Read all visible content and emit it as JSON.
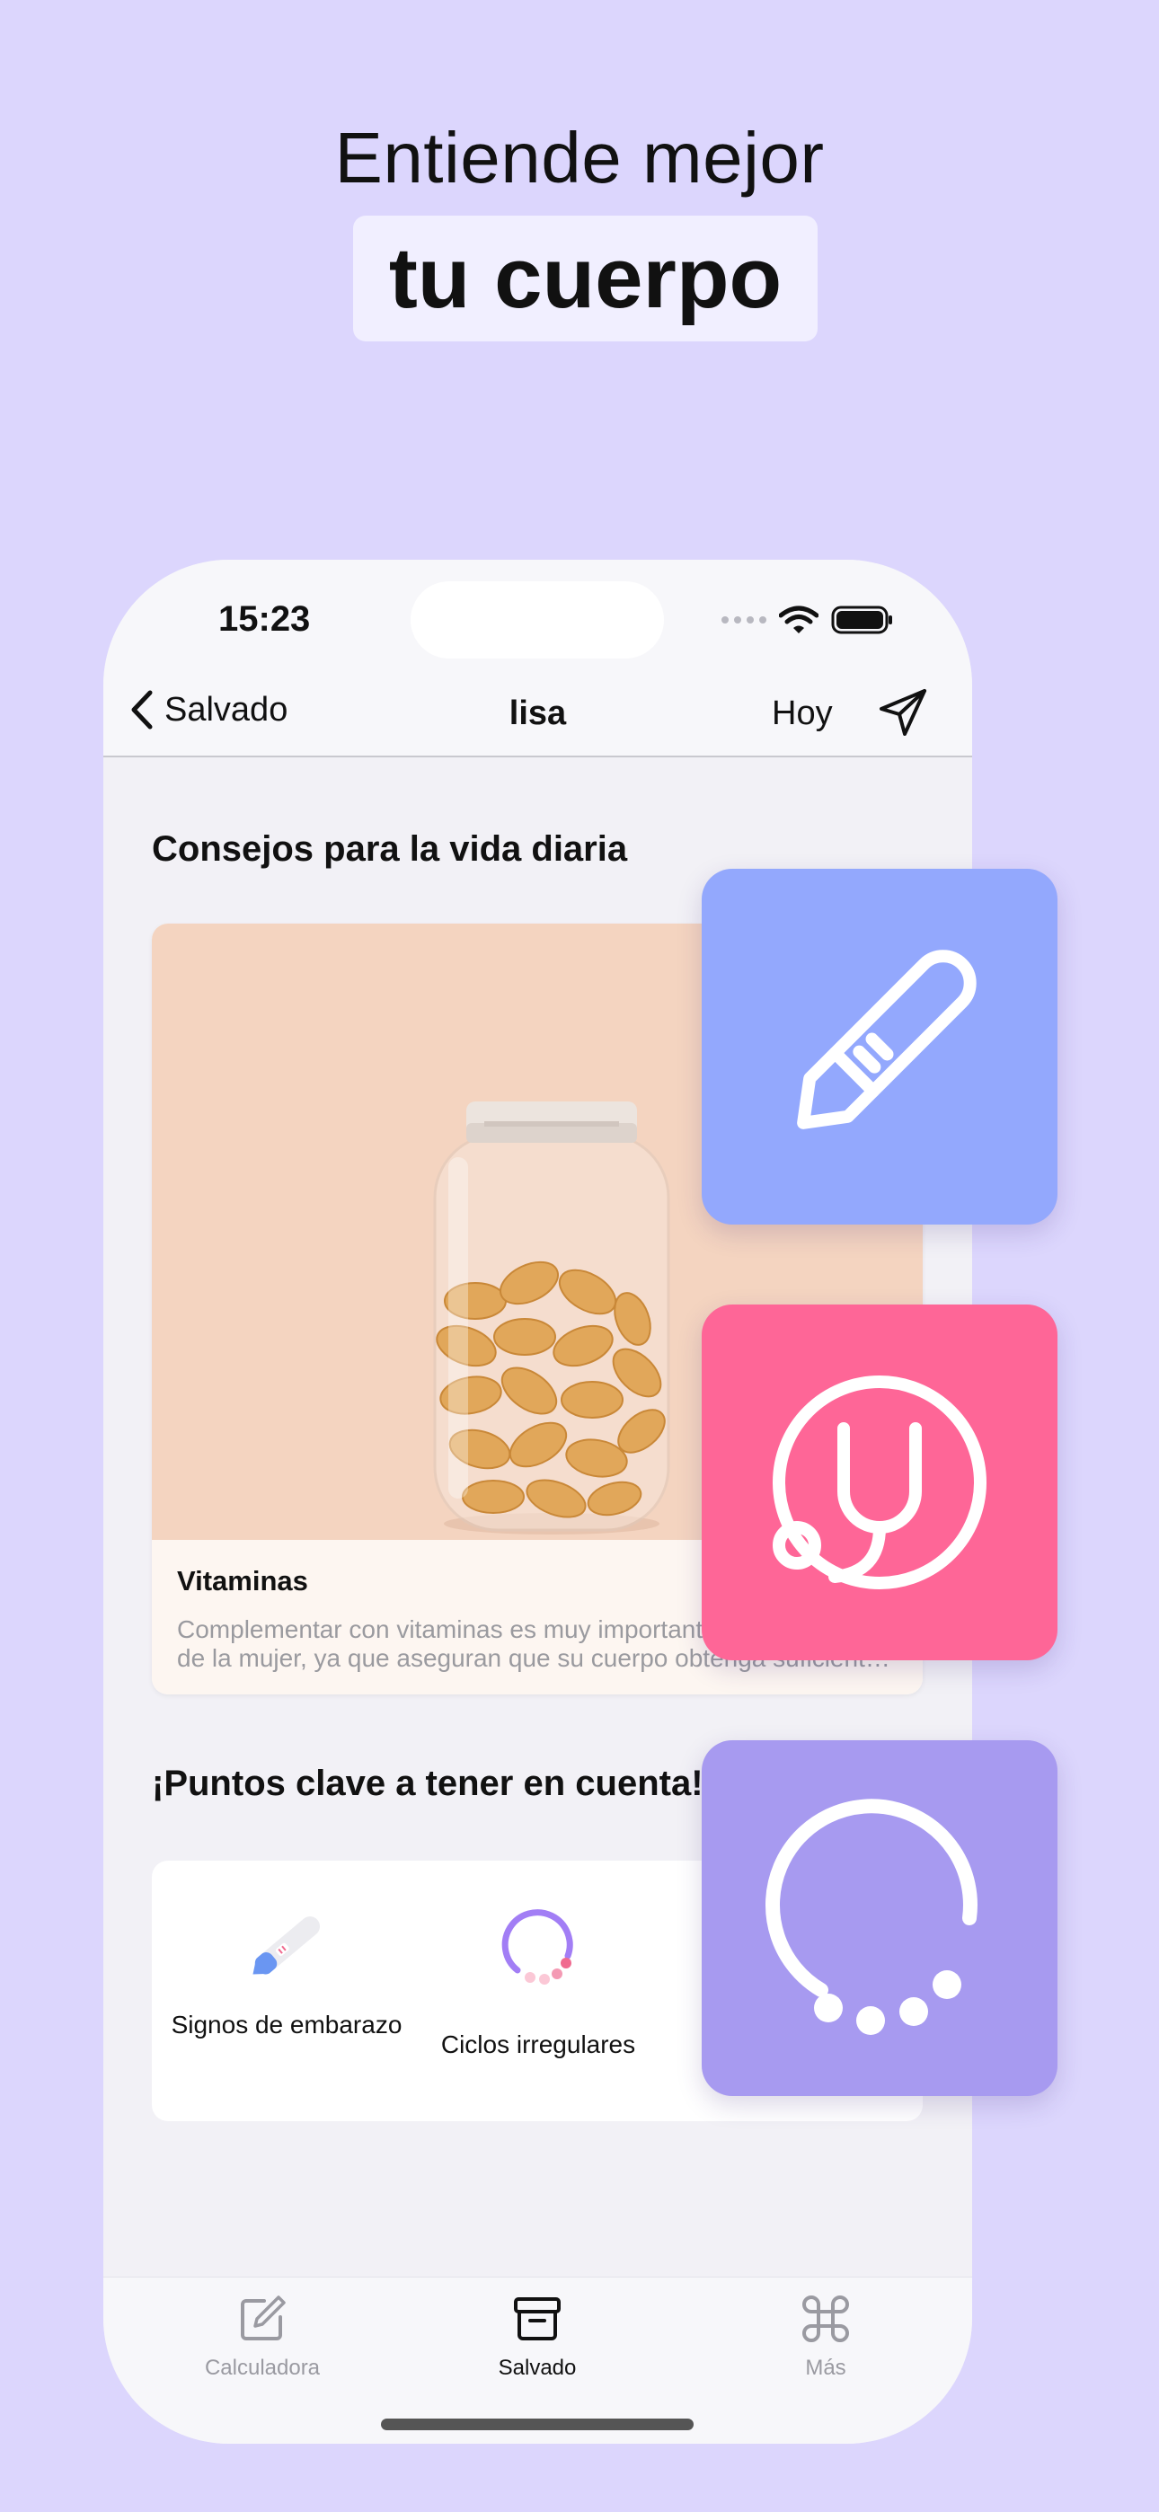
{
  "promo": {
    "headline_line1": "Entiende mejor",
    "headline_line2": "tu cuerpo"
  },
  "status_bar": {
    "time": "15:23"
  },
  "nav": {
    "back_label": "Salvado",
    "title": "lisa",
    "today_label": "Hoy"
  },
  "tips": {
    "section_title": "Consejos para la vida diaria",
    "card": {
      "title": "Vitaminas",
      "text": "Complementar con vitaminas es muy importante para la salud de la mujer, ya que aseguran que su cuerpo obtenga suficientes nutrientes..."
    }
  },
  "key_points": {
    "section_title": "¡Puntos clave a tener en cuenta!",
    "items": [
      {
        "label": "Signos de embarazo",
        "icon": "pregnancy-test-icon"
      },
      {
        "label": "Ciclos irregulares",
        "icon": "cycle-icon"
      }
    ]
  },
  "tab_bar": {
    "items": [
      {
        "label": "Calculadora",
        "icon": "edit-icon",
        "active": false
      },
      {
        "label": "Salvado",
        "icon": "archive-icon",
        "active": true
      },
      {
        "label": "Más",
        "icon": "command-icon",
        "active": false
      }
    ]
  },
  "floating_tiles": [
    {
      "icon": "pregnancy-test-icon",
      "color": "#93a8fd"
    },
    {
      "icon": "stethoscope-icon",
      "color": "#fe6697"
    },
    {
      "icon": "cycle-icon",
      "color": "#a79af0"
    }
  ],
  "colors": {
    "background": "#dcd6fd",
    "accent_purple": "#a27ef5",
    "accent_pink": "#fe6697",
    "accent_blue": "#93a8fd"
  }
}
